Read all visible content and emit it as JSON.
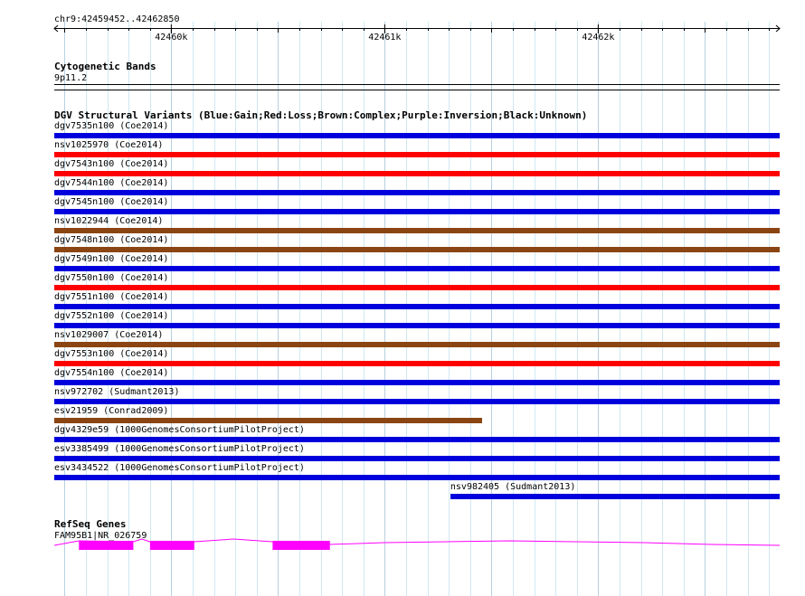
{
  "region": {
    "locus": "chr9:42459452..42462850",
    "start": 42459452,
    "end": 42462850
  },
  "ruler": {
    "ticks": [
      {
        "label": "42460k",
        "pos": 42460000
      },
      {
        "label": "42461k",
        "pos": 42461000
      },
      {
        "label": "42462k",
        "pos": 42462000
      }
    ]
  },
  "cytoband_track": {
    "title": "Cytogenetic Bands",
    "band": "9p11.2"
  },
  "dgv_track": {
    "title": "DGV Structural Variants (Blue:Gain;Red:Loss;Brown:Complex;Purple:Inversion;Black:Unknown)",
    "colors": {
      "gain": "#0000dd",
      "loss": "#ff0000",
      "complex": "#8b4513"
    },
    "features": [
      {
        "label": "dgv7535n100 (Coe2014)",
        "type": "gain",
        "start_frac": 0.0,
        "end_frac": 1.0
      },
      {
        "label": "nsv1025970 (Coe2014)",
        "type": "loss",
        "start_frac": 0.0,
        "end_frac": 1.0
      },
      {
        "label": "dgv7543n100 (Coe2014)",
        "type": "loss",
        "start_frac": 0.0,
        "end_frac": 1.0
      },
      {
        "label": "dgv7544n100 (Coe2014)",
        "type": "gain",
        "start_frac": 0.0,
        "end_frac": 1.0
      },
      {
        "label": "dgv7545n100 (Coe2014)",
        "type": "gain",
        "start_frac": 0.0,
        "end_frac": 1.0
      },
      {
        "label": "nsv1022944 (Coe2014)",
        "type": "complex",
        "start_frac": 0.0,
        "end_frac": 1.0
      },
      {
        "label": "dgv7548n100 (Coe2014)",
        "type": "complex",
        "start_frac": 0.0,
        "end_frac": 1.0
      },
      {
        "label": "dgv7549n100 (Coe2014)",
        "type": "gain",
        "start_frac": 0.0,
        "end_frac": 1.0
      },
      {
        "label": "dgv7550n100 (Coe2014)",
        "type": "loss",
        "start_frac": 0.0,
        "end_frac": 1.0
      },
      {
        "label": "dgv7551n100 (Coe2014)",
        "type": "gain",
        "start_frac": 0.0,
        "end_frac": 1.0
      },
      {
        "label": "dgv7552n100 (Coe2014)",
        "type": "gain",
        "start_frac": 0.0,
        "end_frac": 1.0
      },
      {
        "label": "nsv1029007 (Coe2014)",
        "type": "complex",
        "start_frac": 0.0,
        "end_frac": 1.0
      },
      {
        "label": "dgv7553n100 (Coe2014)",
        "type": "loss",
        "start_frac": 0.0,
        "end_frac": 1.0
      },
      {
        "label": "dgv7554n100 (Coe2014)",
        "type": "gain",
        "start_frac": 0.0,
        "end_frac": 1.0
      },
      {
        "label": "nsv972702 (Sudmant2013)",
        "type": "gain",
        "start_frac": 0.0,
        "end_frac": 1.0
      },
      {
        "label": "esv21959 (Conrad2009)",
        "type": "complex",
        "start_frac": 0.0,
        "end_frac": 0.59
      },
      {
        "label": "dgv4329e59 (1000GenomesConsortiumPilotProject)",
        "type": "gain",
        "start_frac": 0.0,
        "end_frac": 1.0
      },
      {
        "label": "esv3385499 (1000GenomesConsortiumPilotProject)",
        "type": "gain",
        "start_frac": 0.0,
        "end_frac": 1.0
      },
      {
        "label": "esv3434522 (1000GenomesConsortiumPilotProject)",
        "type": "gain",
        "start_frac": 0.0,
        "end_frac": 1.0
      },
      {
        "label": "nsv982405 (Sudmant2013)",
        "type": "gain",
        "start_frac": 0.546,
        "end_frac": 1.0
      }
    ]
  },
  "refseq_track": {
    "title": "RefSeq Genes",
    "gene_label": "FAM95B1|NR_026759",
    "color": "#ff00ff",
    "exons": [
      {
        "start_frac": 0.034,
        "end_frac": 0.109
      },
      {
        "start_frac": 0.132,
        "end_frac": 0.193
      },
      {
        "start_frac": 0.301,
        "end_frac": 0.38
      }
    ]
  }
}
